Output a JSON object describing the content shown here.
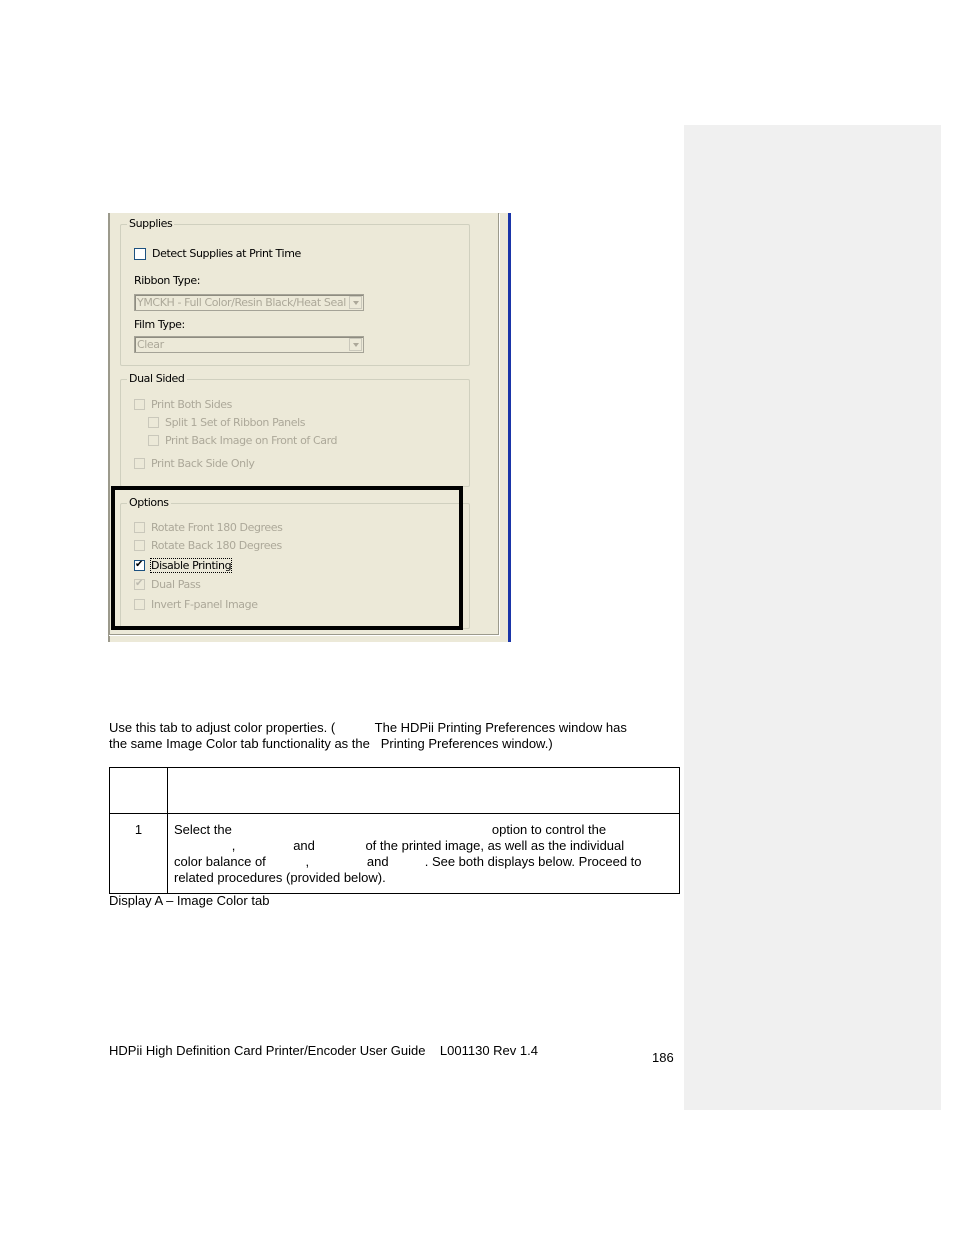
{
  "dialog": {
    "supplies": {
      "title": "Supplies",
      "detect_supplies": {
        "label": "Detect Supplies at Print Time",
        "checked": false,
        "enabled": true
      },
      "ribbon_type_label": "Ribbon Type:",
      "ribbon_type_value": "YMCKH - Full Color/Resin Black/Heat Seal",
      "film_type_label": "Film Type:",
      "film_type_value": "Clear"
    },
    "dual_sided": {
      "title": "Dual Sided",
      "print_both_sides": {
        "label": "Print Both Sides",
        "checked": false,
        "enabled": false
      },
      "split_ribbon": {
        "label": "Split 1 Set of Ribbon Panels",
        "checked": false,
        "enabled": false
      },
      "print_back_on_front": {
        "label": "Print Back Image on Front of Card",
        "checked": false,
        "enabled": false
      },
      "print_back_only": {
        "label": "Print Back Side Only",
        "checked": false,
        "enabled": false
      }
    },
    "options": {
      "title": "Options",
      "rotate_front": {
        "label": "Rotate Front 180 Degrees",
        "checked": false,
        "enabled": false
      },
      "rotate_back": {
        "label": "Rotate Back 180 Degrees",
        "checked": false,
        "enabled": false
      },
      "disable_printing": {
        "label": "Disable Printing",
        "checked": true,
        "enabled": true
      },
      "dual_pass": {
        "label": "Dual Pass",
        "checked": true,
        "enabled": false
      },
      "invert_fpanel": {
        "label": "Invert F-panel Image",
        "checked": false,
        "enabled": false
      }
    },
    "checkmark_glyph": "✔"
  },
  "document": {
    "intro_line1": "Use this tab to adjust color properties. (           The HDPii Printing Preferences window has",
    "intro_line2": "the same Image Color tab functionality as the   Printing Preferences window.)",
    "table": {
      "header": [
        "",
        ""
      ],
      "rows": [
        {
          "step": "1",
          "lines": [
            "Select the                                                                        option to control the",
            "                ,                and              of the printed image, as well as the individual",
            "color balance of           ,                and          . See both displays below. Proceed to",
            "related procedures (provided below)."
          ]
        }
      ]
    },
    "caption": "Display A – Image Color tab",
    "footer": "HDPii High Definition Card Printer/Encoder User Guide    L001130 Rev 1.4",
    "page_number": "186"
  }
}
